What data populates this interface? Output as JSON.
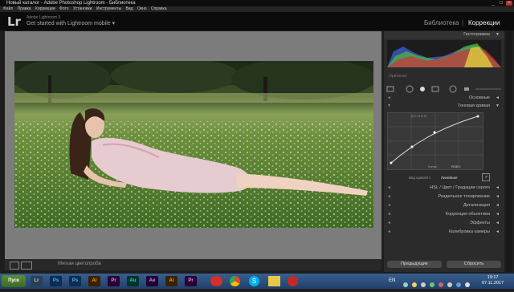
{
  "titlebar": {
    "title": "Новый каталог - Adobe Photoshop Lightroom - Библиотека",
    "minimize": "_",
    "maximize": "□",
    "close": "×"
  },
  "menu": [
    "Файл",
    "Правка",
    "Коррекции",
    "Фото",
    "Установки",
    "Инструменты",
    "Вид",
    "Окно",
    "Справка"
  ],
  "identity": {
    "logo": "Lr",
    "product": "Adobe Lightroom 5",
    "mobile": "Get started with Lightroom mobile ▾"
  },
  "modules": {
    "library": "Библиотека",
    "separator": "|",
    "develop": "Коррекции"
  },
  "panel": {
    "histogram": "Гистограмма",
    "original": "Оригинал",
    "basic": "Основные",
    "tone_curve": "Тоновая кривая",
    "curve_readout": "0.0 / 0.0 %",
    "curve_channel_label": "Канал :",
    "curve_channel_value": "RGB ◊",
    "point_curve": "Вид кривой ◊",
    "point_curve_value": "Линейная",
    "hsl": "HSL / Цвет / Градации серого",
    "split_toning": "Раздельное тонирование",
    "detail": "Детализация",
    "lens": "Коррекция объектива",
    "effects": "Эффекты",
    "calibration": "Калибровка камеры",
    "previous": "Предыдущие",
    "reset": "Сбросить"
  },
  "toolbar": {
    "soft_proof": "Мягкая цветопроба"
  },
  "taskbar": {
    "start": "Пуск",
    "apps": [
      {
        "label": "Lr",
        "color": "#2b3f54",
        "fg": "#9fd0ff"
      },
      {
        "label": "Ps",
        "color": "#0b2d4f",
        "fg": "#4fb3ff"
      },
      {
        "label": "Ps",
        "color": "#0b2d4f",
        "fg": "#4fb3ff"
      },
      {
        "label": "Ai",
        "color": "#3a2100",
        "fg": "#ff9a00"
      },
      {
        "label": "Pr",
        "color": "#2a0033",
        "fg": "#e28cff"
      },
      {
        "label": "Au",
        "color": "#00332c",
        "fg": "#00e4bb"
      },
      {
        "label": "Ae",
        "color": "#1e0033",
        "fg": "#d08cff"
      },
      {
        "label": "Ai",
        "color": "#3a2100",
        "fg": "#ff9a00"
      },
      {
        "label": "Pr",
        "color": "#2a0033",
        "fg": "#e28cff"
      }
    ],
    "lang": "EN",
    "time": "19:17",
    "date": "07.11.2017"
  },
  "colors": {
    "accent": "#3b6aa0",
    "panel": "#2b2b2b"
  }
}
